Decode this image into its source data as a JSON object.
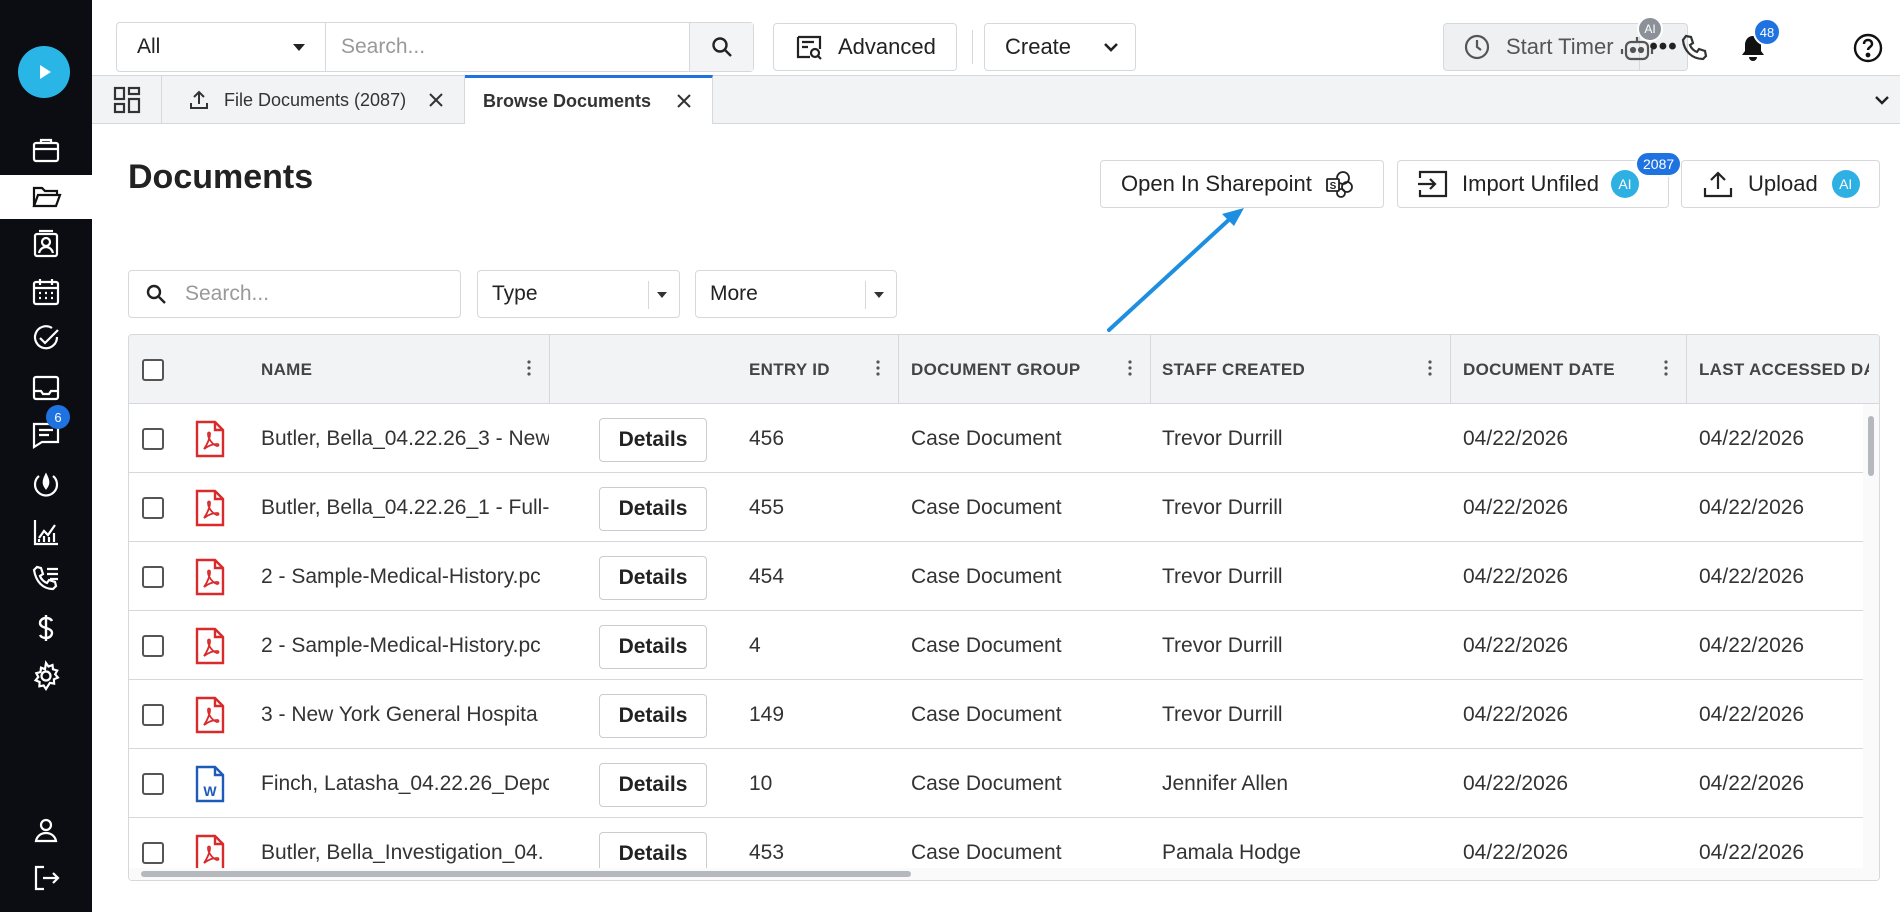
{
  "header": {
    "scope_value": "All",
    "search_placeholder": "Search...",
    "advanced_label": "Advanced",
    "create_label": "Create",
    "timer_label": "Start Timer",
    "more_label": "•••",
    "ai_badge": "AI",
    "notification_count": "48"
  },
  "sidebar": {
    "messages_badge": "6",
    "items": [
      "play-logo",
      "cases",
      "documents",
      "contacts",
      "calendar",
      "tasks",
      "inbox",
      "messages",
      "intake",
      "reports",
      "call-log",
      "billing",
      "settings",
      "profile",
      "logout"
    ]
  },
  "tabs": [
    {
      "label": "File Documents (2087)"
    },
    {
      "label": "Browse Documents"
    }
  ],
  "page": {
    "title": "Documents",
    "sharepoint_label": "Open In Sharepoint",
    "import_label": "Import Unfiled",
    "import_count": "2087",
    "upload_label": "Upload",
    "ai_label": "AI"
  },
  "filters": {
    "search_placeholder": "Search...",
    "type_label": "Type",
    "more_label": "More"
  },
  "table": {
    "columns": [
      "NAME",
      "ENTRY ID",
      "DOCUMENT GROUP",
      "STAFF CREATED",
      "DOCUMENT DATE",
      "LAST ACCESSED DAT"
    ],
    "details_label": "Details",
    "rows": [
      {
        "icon": "pdf",
        "name": "Butler, Bella_04.22.26_3 - New",
        "entry_id": "456",
        "group": "Case Document",
        "staff": "Trevor Durrill",
        "doc_date": "04/22/2026",
        "last_accessed": "04/22/2026"
      },
      {
        "icon": "pdf",
        "name": "Butler, Bella_04.22.26_1 - Full-",
        "entry_id": "455",
        "group": "Case Document",
        "staff": "Trevor Durrill",
        "doc_date": "04/22/2026",
        "last_accessed": "04/22/2026"
      },
      {
        "icon": "pdf",
        "name": "2 - Sample-Medical-History.pc",
        "entry_id": "454",
        "group": "Case Document",
        "staff": "Trevor Durrill",
        "doc_date": "04/22/2026",
        "last_accessed": "04/22/2026"
      },
      {
        "icon": "pdf",
        "name": "2 - Sample-Medical-History.pc",
        "entry_id": "4",
        "group": "Case Document",
        "staff": "Trevor Durrill",
        "doc_date": "04/22/2026",
        "last_accessed": "04/22/2026"
      },
      {
        "icon": "pdf",
        "name": "3 - New York General Hospita",
        "entry_id": "149",
        "group": "Case Document",
        "staff": "Trevor Durrill",
        "doc_date": "04/22/2026",
        "last_accessed": "04/22/2026"
      },
      {
        "icon": "word",
        "name": "Finch, Latasha_04.22.26_Depc",
        "entry_id": "10",
        "group": "Case Document",
        "staff": "Jennifer Allen",
        "doc_date": "04/22/2026",
        "last_accessed": "04/22/2026"
      },
      {
        "icon": "pdf",
        "name": "Butler, Bella_Investigation_04.",
        "entry_id": "453",
        "group": "Case Document",
        "staff": "Pamala Hodge",
        "doc_date": "04/22/2026",
        "last_accessed": "04/22/2026"
      }
    ]
  },
  "colors": {
    "accent": "#1f73e0",
    "brand": "#29b6e6",
    "sidebar_bg": "#0b0d12",
    "pdf_red": "#d92b2b",
    "word_blue": "#1e5bb8",
    "annotation_arrow": "#1e8fe0"
  }
}
